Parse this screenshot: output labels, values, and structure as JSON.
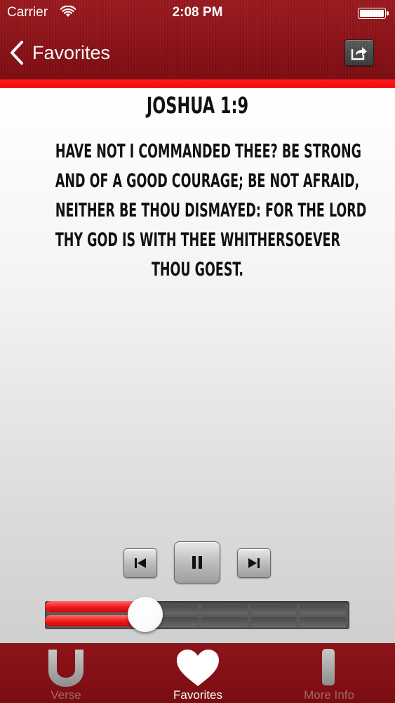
{
  "status_bar": {
    "carrier": "Carrier",
    "time": "2:08 PM"
  },
  "nav": {
    "back_label": "Favorites",
    "share_icon": "share-icon"
  },
  "verse": {
    "reference": "JOSHUA 1:9",
    "lines": [
      "HAVE NOT I COMMANDED THEE? BE STRONG",
      "AND OF A GOOD COURAGE; BE NOT AFRAID,",
      "NEITHER BE THOU DISMAYED: FOR THE LORD",
      "THY GOD IS WITH THEE WHITHERSOEVER",
      "THOU GOEST."
    ]
  },
  "player": {
    "state": "playing",
    "progress": 0.33
  },
  "tabs": [
    {
      "label": "Verse",
      "icon": "verse-icon",
      "active": false
    },
    {
      "label": "Favorites",
      "icon": "heart-icon",
      "active": true
    },
    {
      "label": "More Info",
      "icon": "info-icon",
      "active": false
    }
  ],
  "colors": {
    "brand_red": "#8a1217",
    "accent_red": "#f20c0c"
  }
}
